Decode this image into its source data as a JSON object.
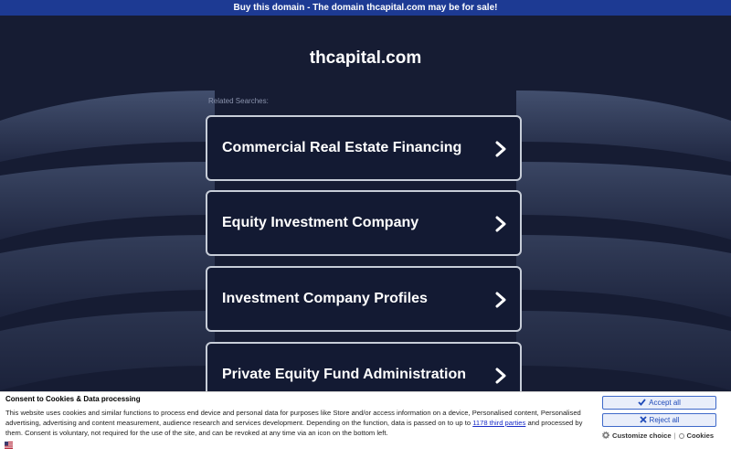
{
  "banner": {
    "text": "Buy this domain - The domain thcapital.com may be for sale!"
  },
  "site": {
    "title": "thcapital.com"
  },
  "related": {
    "heading": "Related Searches:",
    "links": [
      {
        "label": "Commercial Real Estate Financing"
      },
      {
        "label": "Equity Investment Company"
      },
      {
        "label": "Investment Company Profiles"
      },
      {
        "label": "Private Equity Fund Administration"
      }
    ]
  },
  "consent": {
    "title": "Consent to Cookies & Data processing",
    "text_before": "This website uses cookies and similar functions to process end device and personal data for purposes like Store and/or access information on a device, Personalised content, Personalised advertising, advertising and content measurement, audience research and services development. Depending on the function, data is passed on to up to ",
    "link_text": "1178 third parties",
    "text_after": " and processed by them. Consent is voluntary, not required for the use of the site, and can be revoked at any time via an icon on the bottom left.",
    "accept_label": "Accept all",
    "reject_label": "Reject all",
    "customize_label": "Customize choice",
    "separator": "|",
    "cookies_label": "Cookies",
    "icons": {
      "accept": "check-icon",
      "reject": "x-icon",
      "customize": "gear-icon",
      "cookies": "circle-icon",
      "language": "us-flag-icon"
    }
  },
  "colors": {
    "banner": "#1d3a93",
    "background": "#161c33",
    "button_border": "#c7cdd8",
    "accent": "#1f4ab8"
  }
}
